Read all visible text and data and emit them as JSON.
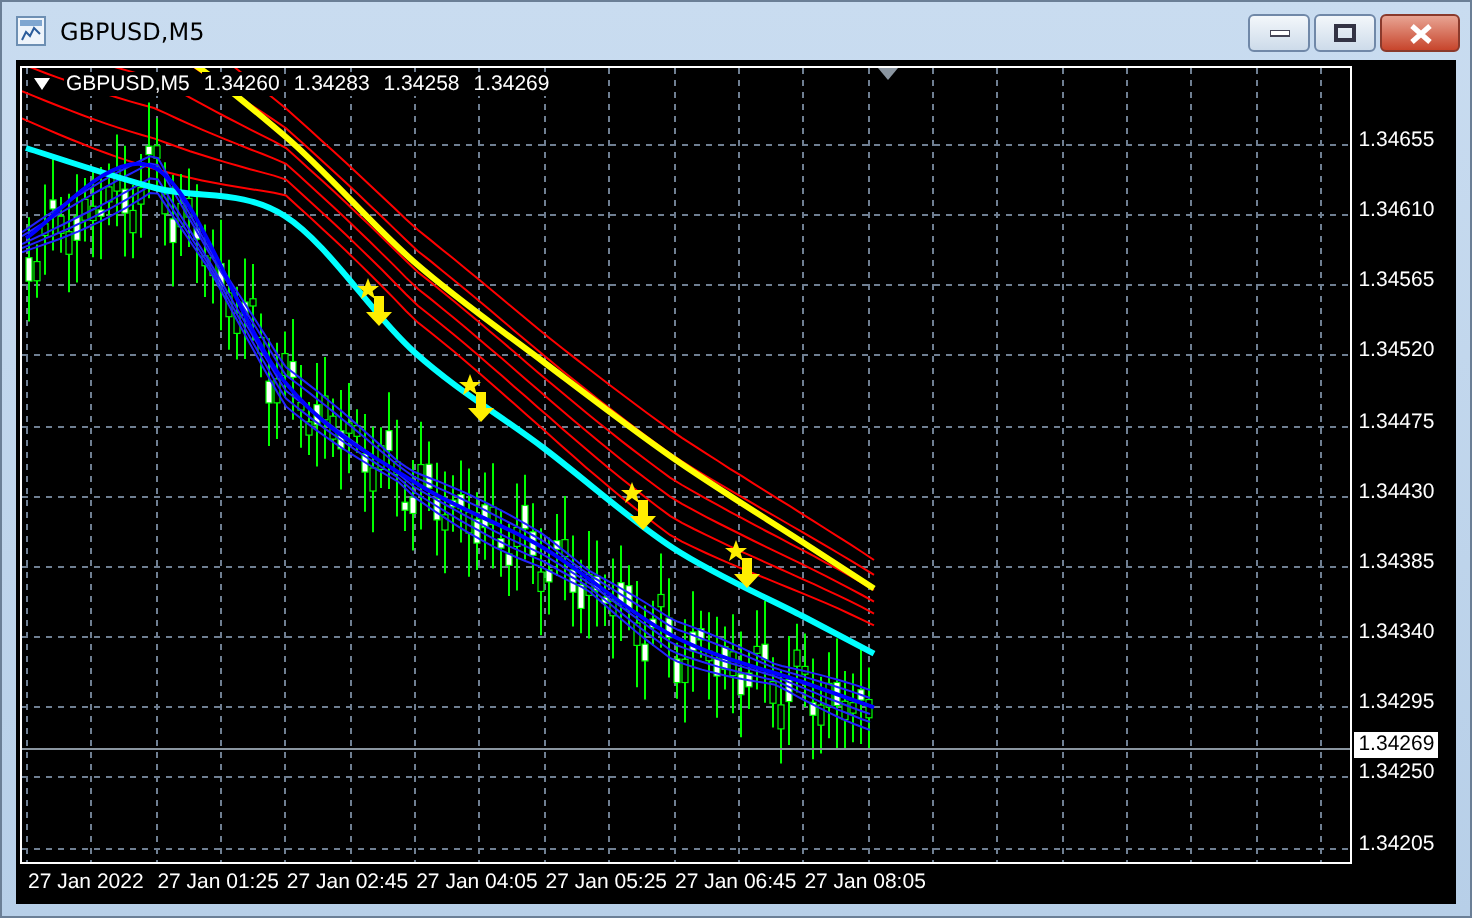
{
  "window": {
    "title": "GBPUSD,M5",
    "controls": [
      {
        "kind": "minimize"
      },
      {
        "kind": "maximize"
      },
      {
        "kind": "close"
      }
    ]
  },
  "chart": {
    "header": {
      "symbol": "GBPUSD,M5",
      "open": "1.34260",
      "high": "1.34283",
      "low": "1.34258",
      "close": "1.34269"
    },
    "price_axis_labels": [
      "1.34655",
      "1.34610",
      "1.34565",
      "1.34520",
      "1.34475",
      "1.34430",
      "1.34385",
      "1.34340",
      "1.34295",
      "1.34250",
      "1.34205"
    ],
    "current_price_label": "1.34269",
    "time_axis_labels": [
      "27 Jan 2022",
      "27 Jan 01:25",
      "27 Jan 02:45",
      "27 Jan 04:05",
      "27 Jan 05:25",
      "27 Jan 06:45",
      "27 Jan 08:05"
    ]
  }
}
